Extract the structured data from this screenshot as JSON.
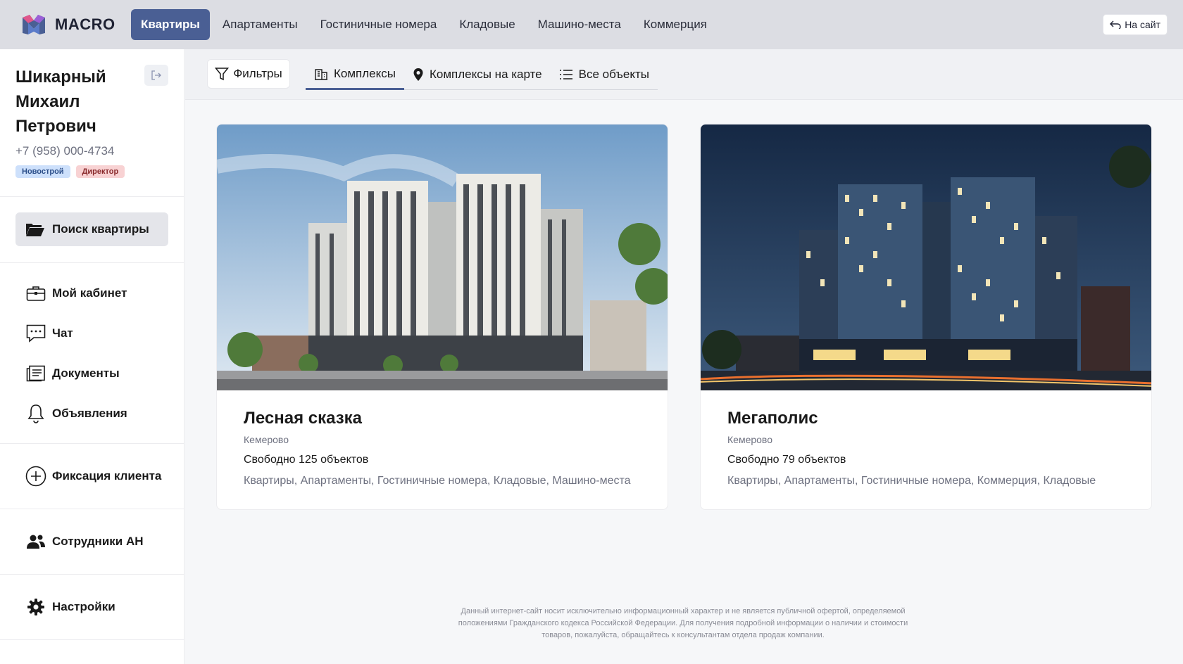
{
  "header": {
    "logo_text": "MACRO",
    "nav": [
      {
        "label": "Квартиры",
        "active": true
      },
      {
        "label": "Апартаменты",
        "active": false
      },
      {
        "label": "Гостиничные номера",
        "active": false
      },
      {
        "label": "Кладовые",
        "active": false
      },
      {
        "label": "Машино-места",
        "active": false
      },
      {
        "label": "Коммерция",
        "active": false
      }
    ],
    "back_site_label": "На сайт"
  },
  "sidebar": {
    "profile": {
      "name_line1": "Шикарный",
      "name_line2": "Михаил",
      "name_line3": "Петрович",
      "phone": "+7 (958) 000-4734",
      "badges": [
        "Новострой",
        "Директор"
      ]
    },
    "search_button": "Поиск квартиры",
    "menu": [
      {
        "label": "Мой кабинет",
        "icon": "briefcase-icon"
      },
      {
        "label": "Чат",
        "icon": "chat-icon"
      },
      {
        "label": "Документы",
        "icon": "documents-icon"
      },
      {
        "label": "Объявления",
        "icon": "bell-icon"
      }
    ],
    "client_fix": "Фиксация клиента",
    "staff": "Сотрудники АН",
    "settings": "Настройки"
  },
  "subtabs": {
    "filters": "Фильтры",
    "tabs": [
      {
        "label": "Комплексы",
        "icon": "building-icon",
        "active": true
      },
      {
        "label": "Комплексы на карте",
        "icon": "map-pin-icon",
        "active": false
      },
      {
        "label": "Все объекты",
        "icon": "list-icon",
        "active": false
      }
    ]
  },
  "complexes": [
    {
      "title": "Лесная сказка",
      "city": "Кемерово",
      "free": "Свободно 125 объектов",
      "types": "Квартиры, Апартаменты, Гостиничные номера, Кладовые, Машино-места"
    },
    {
      "title": "Мегаполис",
      "city": "Кемерово",
      "free": "Свободно 79 объектов",
      "types": "Квартиры, Апартаменты, Гостиничные номера, Коммерция, Кладовые"
    }
  ],
  "footer": {
    "line1": "Данный интернет-сайт носит исключительно информационный характер и не является публичной офертой, определяемой",
    "line2": "положениями Гражданского кодекса Российской Федерации. Для получения подробной информации о наличии и стоимости",
    "line3": "товаров, пожалуйста, обращайтесь к консультантам отдела продаж компании."
  },
  "colors": {
    "accent": "#4a5f94",
    "topbar": "#dcdde3",
    "badge_blue": "#cde0fb",
    "badge_red": "#f8d2d3"
  }
}
